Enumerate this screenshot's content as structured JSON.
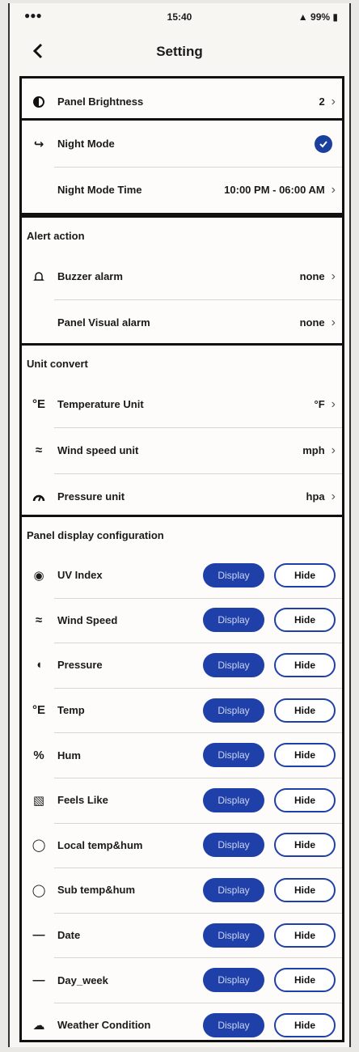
{
  "status_bar": {
    "time": "15:40",
    "battery": "99%"
  },
  "nav": {
    "title": "Setting"
  },
  "brightness": {
    "label": "Panel Brightness",
    "value": "2"
  },
  "night": {
    "mode_label": "Night Mode",
    "time_label": "Night Mode Time",
    "time_value": "10:00 PM - 06:00 AM"
  },
  "alert": {
    "header": "Alert action",
    "buzzer_label": "Buzzer alarm",
    "buzzer_value": "none",
    "visual_label": "Panel Visual alarm",
    "visual_value": "none"
  },
  "unit": {
    "header": "Unit convert",
    "temp_label": "Temperature Unit",
    "temp_value": "°F",
    "wind_label": "Wind speed unit",
    "wind_value": "mph",
    "pressure_label": "Pressure unit",
    "pressure_value": "hpa"
  },
  "config": {
    "header": "Panel display configuration",
    "display_label": "Display",
    "hide_label": "Hide",
    "items": [
      {
        "label": "UV Index",
        "icon": "uv-icon"
      },
      {
        "label": "Wind Speed",
        "icon": "wind-icon"
      },
      {
        "label": "Pressure",
        "icon": "pressure-icon"
      },
      {
        "label": "Temp",
        "icon": "thermometer-icon"
      },
      {
        "label": "Hum",
        "icon": "humidity-icon"
      },
      {
        "label": "Feels Like",
        "icon": "feels-like-icon"
      },
      {
        "label": "Local temp&hum",
        "icon": "bulb-icon"
      },
      {
        "label": "Sub temp&hum",
        "icon": "sensor-icon"
      },
      {
        "label": "Date",
        "icon": "date-icon"
      },
      {
        "label": "Day_week",
        "icon": "day-week-icon"
      },
      {
        "label": "Weather Condition",
        "icon": "weather-icon"
      }
    ]
  },
  "colors": {
    "accent": "#1e40a8"
  }
}
